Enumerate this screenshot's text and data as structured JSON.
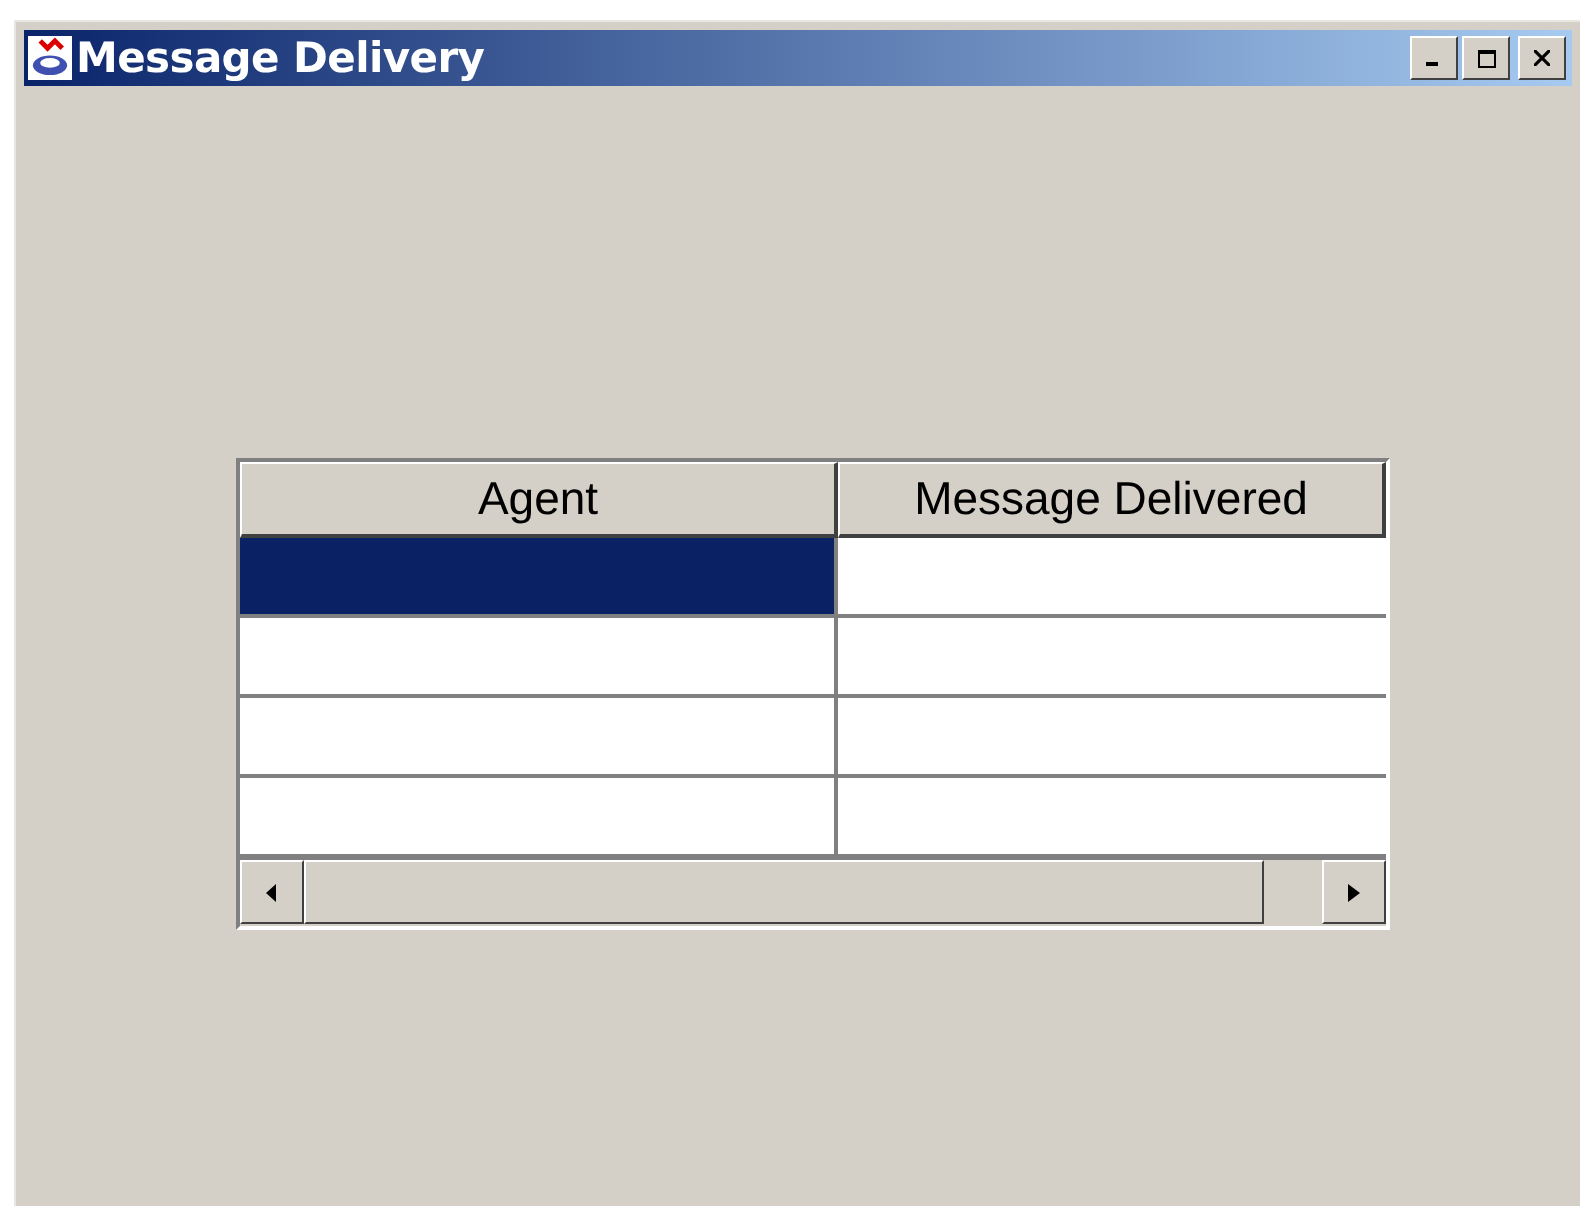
{
  "window": {
    "title": "Message Delivery",
    "controls": [
      {
        "kind": "minimize"
      },
      {
        "kind": "maximize"
      },
      {
        "kind": "close"
      }
    ]
  },
  "table": {
    "columns": [
      "Agent",
      "Message Delivered"
    ],
    "rows": [
      {
        "cells": [
          {
            "selected": true
          },
          {
            "selected": false
          }
        ]
      },
      {
        "cells": [
          {
            "selected": false
          },
          {
            "selected": false
          }
        ]
      },
      {
        "cells": [
          {
            "selected": false
          },
          {
            "selected": false
          }
        ]
      },
      {
        "cells": [
          {
            "selected": false
          },
          {
            "selected": false
          }
        ]
      }
    ]
  }
}
